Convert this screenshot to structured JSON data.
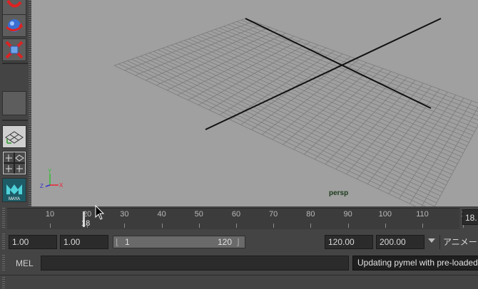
{
  "toolbox": {
    "tools": [
      {
        "name": "rotate-tool",
        "icon": "rotate-arrow-icon"
      },
      {
        "name": "scale-tool",
        "icon": "sphere-rotate-icon"
      },
      {
        "name": "last-tool",
        "icon": "cube-scale-icon"
      },
      {
        "name": "empty-tool-slot",
        "icon": ""
      },
      {
        "name": "single-perspective-layout",
        "icon": "perspective-grid-icon"
      },
      {
        "name": "four-view-layout",
        "icon": "four-view-icon"
      },
      {
        "name": "maya-logo",
        "icon": "maya-logo-icon",
        "logo_text": "MAYA"
      }
    ]
  },
  "viewport": {
    "camera_label": "persp",
    "background_color": "#a0a0a0",
    "grid_color": "#7c7c7c",
    "axis_color": "#111111",
    "axis_indicator": {
      "x": "X",
      "y": "Y",
      "z": "Z"
    }
  },
  "time_slider": {
    "ticks": [
      "10",
      "20",
      "30",
      "40",
      "50",
      "60",
      "70",
      "80",
      "90",
      "100",
      "110",
      "1"
    ],
    "current_frame_label": "18",
    "current_frame_field": "18."
  },
  "range_slider": {
    "start_time": "1.00",
    "playback_start": "1.00",
    "range_start": "1",
    "range_end": "120",
    "playback_end": "120.00",
    "end_time": "200.00",
    "anim_prefs_label": "アニメーシ"
  },
  "command_line": {
    "language_label": "MEL",
    "input_value": "",
    "result_text": "Updating pymel with pre-loaded"
  }
}
